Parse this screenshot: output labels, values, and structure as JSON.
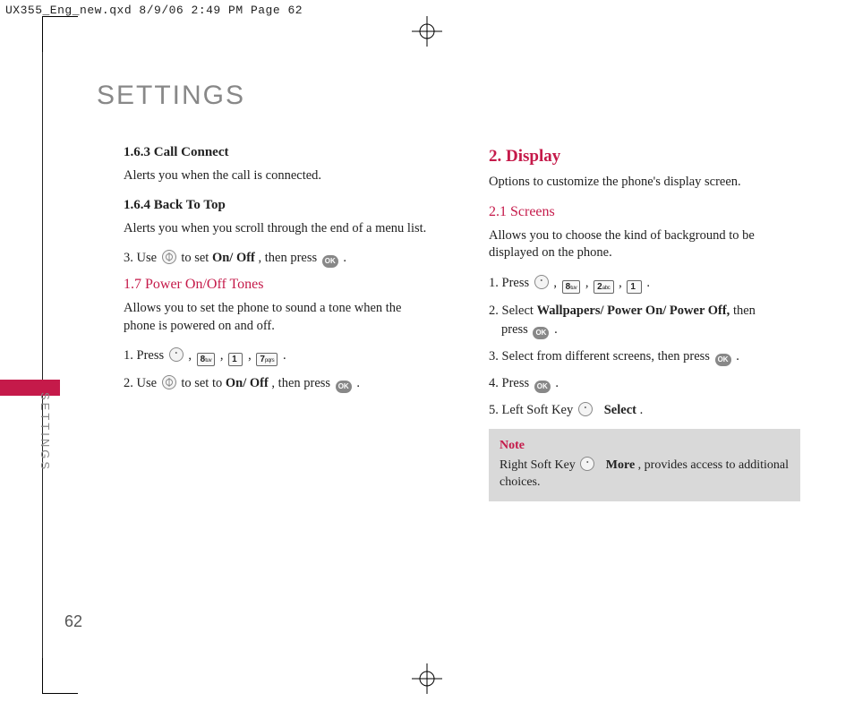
{
  "meta": {
    "file_info": "UX355_Eng_new.qxd  8/9/06  2:49 PM  Page 62"
  },
  "page": {
    "title": "SETTINGS",
    "side_label": "SETTINGS",
    "page_number": "62"
  },
  "left": {
    "s163": {
      "heading": "1.6.3 Call Connect",
      "body": "Alerts you when the call is connected."
    },
    "s164": {
      "heading": "1.6.4 Back To Top",
      "body": "Alerts you when you scroll through the end of a menu list.",
      "step3a": "3. Use ",
      "step3b": " to set ",
      "step3bold": "On/ Off",
      "step3c": ", then press ",
      "ok": "OK",
      "dot": "."
    },
    "s17": {
      "heading": "1.7 Power On/Off Tones",
      "body": "Allows you to set the phone to sound a tone when the phone is powered on and off.",
      "step1": "1. Press ",
      "comma": " , ",
      "key8": {
        "num": "8",
        "sub": "tuv"
      },
      "key1": {
        "num": "1",
        "sub": ""
      },
      "key7": {
        "num": "7",
        "sub": "pqrs"
      },
      "dot": ".",
      "step2a": "2. Use ",
      "step2b": " to set to ",
      "onoff": "On/ Off",
      "step2c": ", then press ",
      "ok": "OK"
    }
  },
  "right": {
    "s2": {
      "heading": "2. Display",
      "body": "Options to customize the phone's display screen."
    },
    "s21": {
      "heading": "2.1 Screens",
      "body": "Allows you to choose the kind of background to be displayed on the phone.",
      "step1": "1. Press ",
      "comma": " , ",
      "key8": {
        "num": "8",
        "sub": "tuv"
      },
      "key2": {
        "num": "2",
        "sub": "abc"
      },
      "key1": {
        "num": "1",
        "sub": ""
      },
      "dot": ".",
      "step2a": "2. Select ",
      "step2bold": "Wallpapers/ Power On/ Power Off,",
      "step2b": " then",
      "step2c": "press ",
      "ok": "OK",
      "step3a": "3. Select from different screens, then press ",
      "step4": "4. Press ",
      "step5a": "5. Left Soft Key ",
      "select": "Select",
      "note_label": "Note",
      "note_a": "Right Soft Key ",
      "more": "More",
      "note_b": ", provides access to additional choices."
    }
  }
}
